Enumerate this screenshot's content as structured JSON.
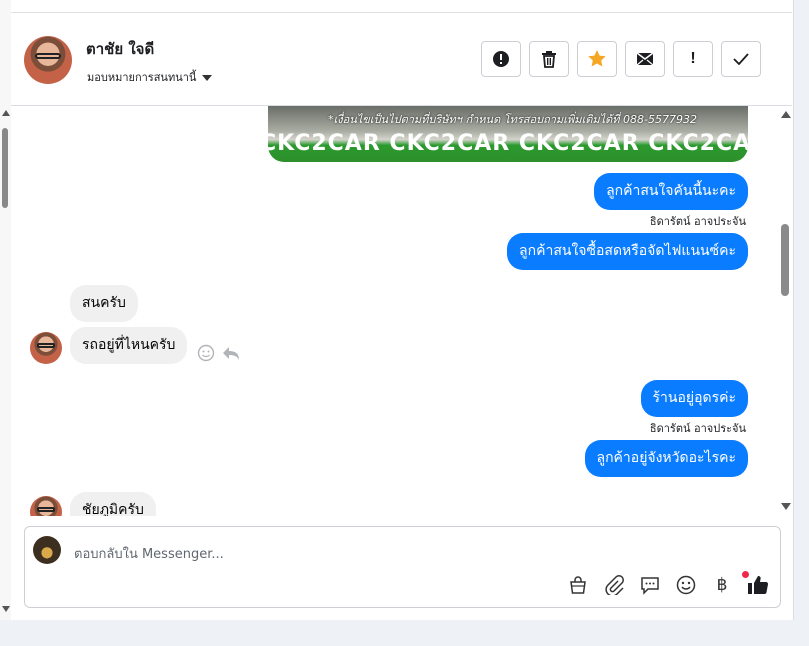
{
  "header": {
    "contact_name": "ตาชัย ใจดี",
    "assign_label": "มอบหมายการสนทนานี้",
    "buttons": [
      {
        "name": "mark-spam",
        "glyph": "⬤"
      },
      {
        "name": "delete",
        "glyph": "🗑"
      },
      {
        "name": "star",
        "glyph": "★"
      },
      {
        "name": "mark-unread",
        "glyph": "✉"
      },
      {
        "name": "follow-up",
        "glyph": "!"
      },
      {
        "name": "mark-done",
        "glyph": "✓"
      }
    ]
  },
  "ad": {
    "line": "*เงื่อนไขเป็นไปตามที่บริษัทฯ กำหนด โทรสอบถามเพิ่มเติมได้ที่ 088-5577932",
    "banner": "CKC2CAR CKC2CAR CKC2CAR CKC2CAR CKC2"
  },
  "messages": [
    {
      "type": "out",
      "text": "ลูกค้าสนใจคันนี้นะคะ"
    },
    {
      "type": "sender",
      "text": "ธิดารัตน์ อาจประจัน"
    },
    {
      "type": "out",
      "text": "ลูกค้าสนใจซื้อสดหรือจัดไฟแนนซ์คะ"
    },
    {
      "type": "in",
      "text": "สนครับ"
    },
    {
      "type": "in",
      "text": "รถอยู่ที่ไหนครับ"
    },
    {
      "type": "out",
      "text": "ร้านอยู่อุดรค่ะ"
    },
    {
      "type": "sender",
      "text": "ธิดารัตน์ อาจประจัน"
    },
    {
      "type": "out",
      "text": "ลูกค้าอยู่จังหวัดอะไรคะ"
    },
    {
      "type": "in",
      "text": "ชัยภูมิครับ"
    }
  ],
  "composer": {
    "placeholder": "ตอบกลับใน Messenger..."
  },
  "colors": {
    "outgoing_bubble": "#0a7cff",
    "incoming_bubble": "#f0f0f0",
    "star": "#f5a623",
    "notification_dot": "#f02849"
  }
}
